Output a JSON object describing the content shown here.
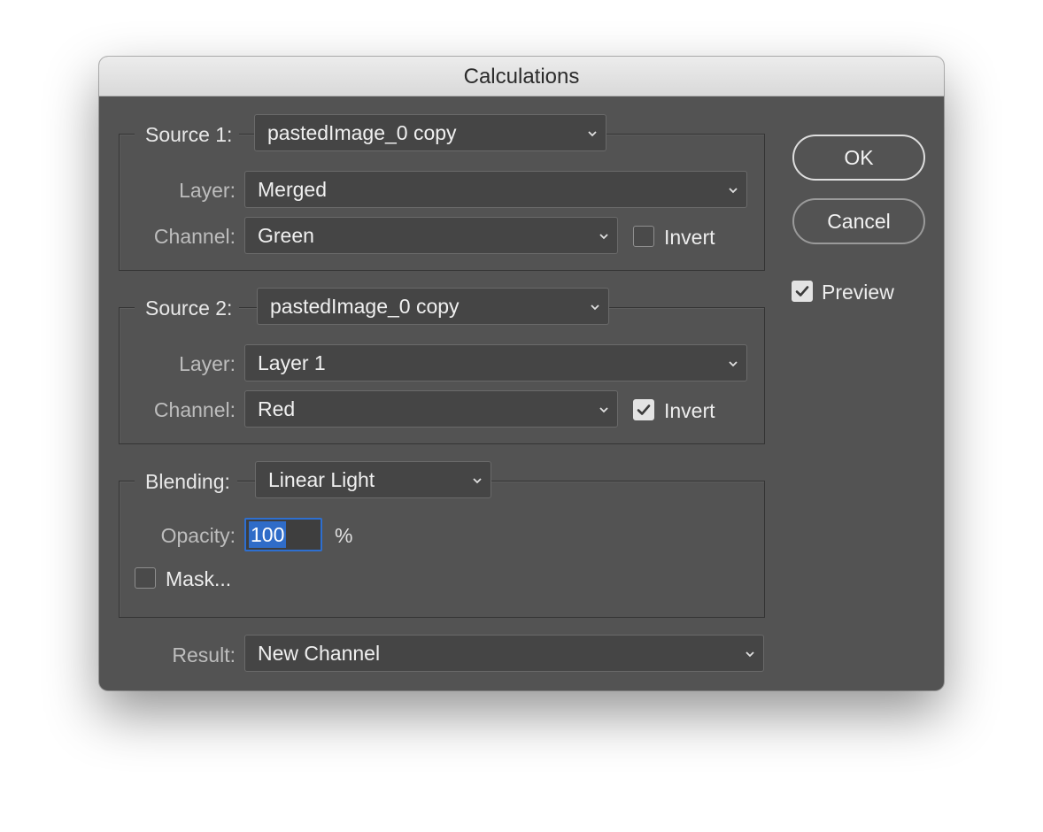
{
  "window": {
    "title": "Calculations"
  },
  "source1": {
    "legend": "Source 1:",
    "file": "pastedImage_0 copy",
    "layer_label": "Layer:",
    "layer": "Merged",
    "channel_label": "Channel:",
    "channel": "Green",
    "invert_label": "Invert",
    "invert_checked": false
  },
  "source2": {
    "legend": "Source 2:",
    "file": "pastedImage_0 copy",
    "layer_label": "Layer:",
    "layer": "Layer 1",
    "channel_label": "Channel:",
    "channel": "Red",
    "invert_label": "Invert",
    "invert_checked": true
  },
  "blending": {
    "legend": "Blending:",
    "mode": "Linear Light",
    "opacity_label": "Opacity:",
    "opacity_value": "100",
    "opacity_unit": "%",
    "mask_label": "Mask...",
    "mask_checked": false
  },
  "result": {
    "label": "Result:",
    "value": "New Channel"
  },
  "buttons": {
    "ok": "OK",
    "cancel": "Cancel"
  },
  "preview": {
    "label": "Preview",
    "checked": true
  },
  "icons": {
    "dropdown": "chevron-down-icon",
    "check": "checkmark-icon"
  }
}
